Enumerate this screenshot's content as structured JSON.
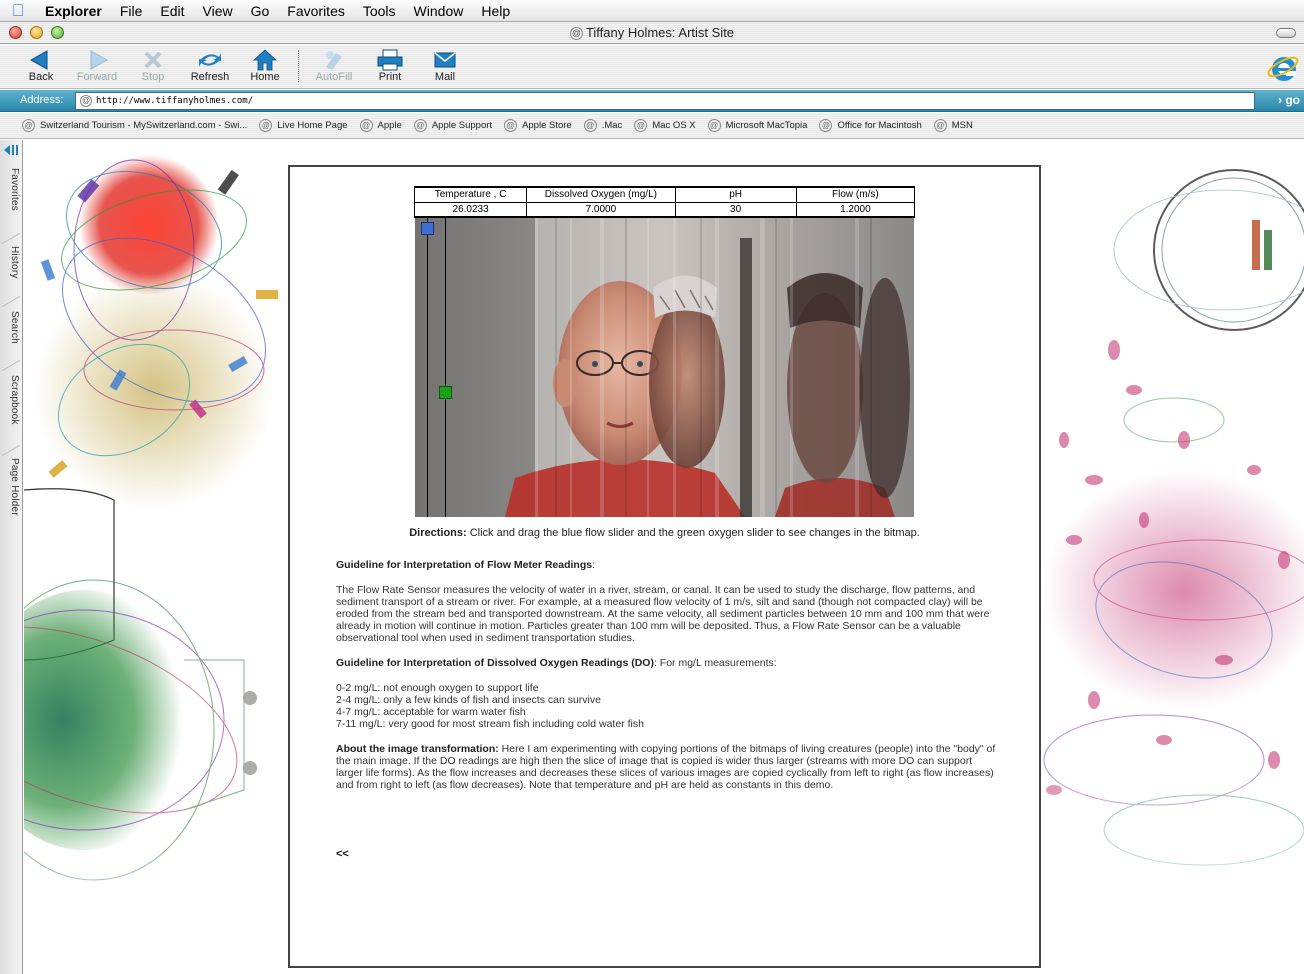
{
  "menubar": {
    "app": "Explorer",
    "items": [
      "File",
      "Edit",
      "View",
      "Go",
      "Favorites",
      "Tools",
      "Window",
      "Help"
    ]
  },
  "window": {
    "title": "Tiffany Holmes: Artist Site"
  },
  "toolbar": {
    "back": "Back",
    "forward": "Forward",
    "stop": "Stop",
    "refresh": "Refresh",
    "home": "Home",
    "autofill": "AutoFill",
    "print": "Print",
    "mail": "Mail"
  },
  "address": {
    "label": "Address:",
    "url": "http://www.tiffanyholmes.com/",
    "go": "go"
  },
  "favorites": [
    "Switzerland Tourism - MySwitzerland.com - Swi...",
    "Live Home Page",
    "Apple",
    "Apple Support",
    "Apple Store",
    ".Mac",
    "Mac OS X",
    "Microsoft MacTopia",
    "Office for Macintosh",
    "MSN"
  ],
  "sidebar": [
    "Favorites",
    "History",
    "Search",
    "Scrapbook",
    "Page Holder"
  ],
  "readings": {
    "headers": [
      "Temperature , C",
      "Dissolved Oxygen (mg/L)",
      "pH",
      "Flow  (m/s)"
    ],
    "values": [
      "26.0233",
      "7.0000",
      "30",
      "1.2000"
    ]
  },
  "directions": {
    "label": "Directions:",
    "text": " Click and drag the blue flow slider and the green oxygen slider to see changes in the bitmap."
  },
  "flow_section": {
    "heading": "Guideline for Interpretation of Flow Meter Readings",
    "suffix": ":",
    "body": "The Flow Rate Sensor measures the velocity of water in a river, stream, or canal. It can be used to study the discharge, flow patterns, and sediment transport of a stream or river. For example, at a measured flow velocity of 1 m/s, silt and sand (though not compacted clay) will be eroded from the stream bed and transported downstream. At the same velocity, all sediment particles between 10 mm and 100 mm that were already in motion will continue in motion. Particles greater than 100 mm will be deposited. Thus, a Flow Rate Sensor can be a valuable observational tool when used in sediment transportation studies."
  },
  "do_section": {
    "heading": "Guideline for Interpretation of Dissolved Oxygen Readings (DO)",
    "suffix": ": For mg/L measurements:",
    "items": [
      "0-2 mg/L: not enough oxygen to support life",
      "2-4 mg/L: only a few kinds of fish and insects can survive",
      "4-7 mg/L: acceptable for warm water fish",
      "7-11 mg/L: very good for most stream fish including cold water fish"
    ]
  },
  "transform_section": {
    "heading": "About the image transformation:",
    "body": " Here I am experimenting with copying portions of the bitmaps of living creatures (people) into the \"body\" of the main image. If the DO readings are high then the slice of image that is copied is wider thus larger (streams with more DO can support larger life forms). As the flow increases and decreases these slices of various images are copied cyclically from left to right (as flow increases) and from right to left (as flow decreases). Note that temperature and pH are held as constants in this demo."
  },
  "back_link": "<<",
  "colors": {
    "flow_slider": "#3f6fd0",
    "oxygen_slider": "#1aa31a",
    "address_bar": "#2a86aa"
  }
}
